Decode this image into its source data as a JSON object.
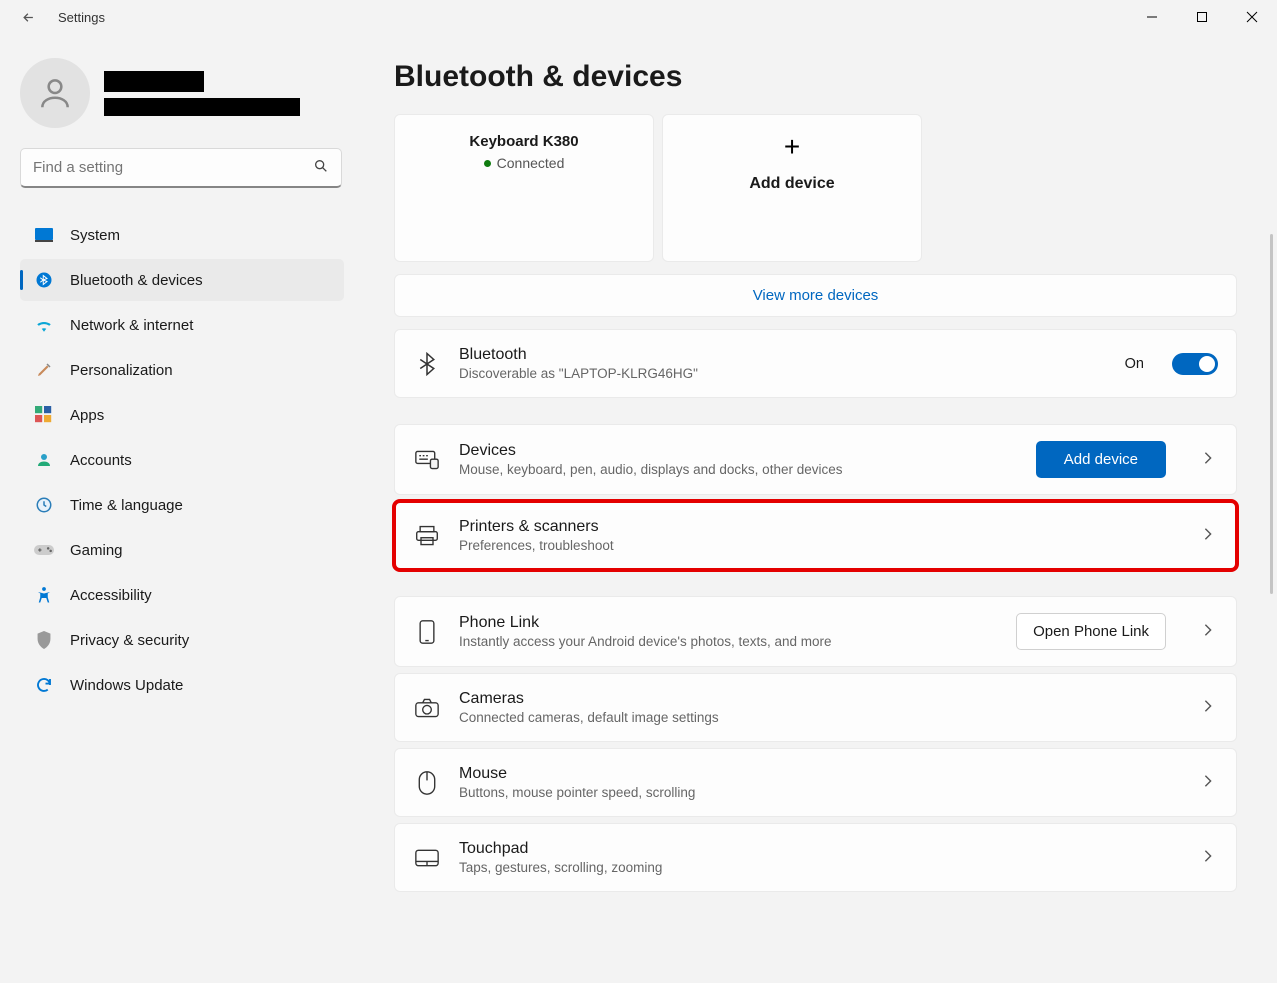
{
  "window": {
    "title": "Settings"
  },
  "search": {
    "placeholder": "Find a setting"
  },
  "sidebar": {
    "items": [
      {
        "label": "System"
      },
      {
        "label": "Bluetooth & devices"
      },
      {
        "label": "Network & internet"
      },
      {
        "label": "Personalization"
      },
      {
        "label": "Apps"
      },
      {
        "label": "Accounts"
      },
      {
        "label": "Time & language"
      },
      {
        "label": "Gaming"
      },
      {
        "label": "Accessibility"
      },
      {
        "label": "Privacy & security"
      },
      {
        "label": "Windows Update"
      }
    ]
  },
  "page": {
    "title": "Bluetooth & devices",
    "device_cards": {
      "keyboard_name": "Keyboard K380",
      "keyboard_status": "Connected",
      "add_label": "Add device"
    },
    "view_more": "View more devices",
    "bluetooth_panel": {
      "title": "Bluetooth",
      "subtitle": "Discoverable as \"LAPTOP-KLRG46HG\"",
      "state": "On"
    },
    "devices_panel": {
      "title": "Devices",
      "subtitle": "Mouse, keyboard, pen, audio, displays and docks, other devices",
      "button": "Add device"
    },
    "printers_panel": {
      "title": "Printers & scanners",
      "subtitle": "Preferences, troubleshoot"
    },
    "phone_panel": {
      "title": "Phone Link",
      "subtitle": "Instantly access your Android device's photos, texts, and more",
      "button": "Open Phone Link"
    },
    "cameras_panel": {
      "title": "Cameras",
      "subtitle": "Connected cameras, default image settings"
    },
    "mouse_panel": {
      "title": "Mouse",
      "subtitle": "Buttons, mouse pointer speed, scrolling"
    },
    "touchpad_panel": {
      "title": "Touchpad",
      "subtitle": "Taps, gestures, scrolling, zooming"
    }
  }
}
